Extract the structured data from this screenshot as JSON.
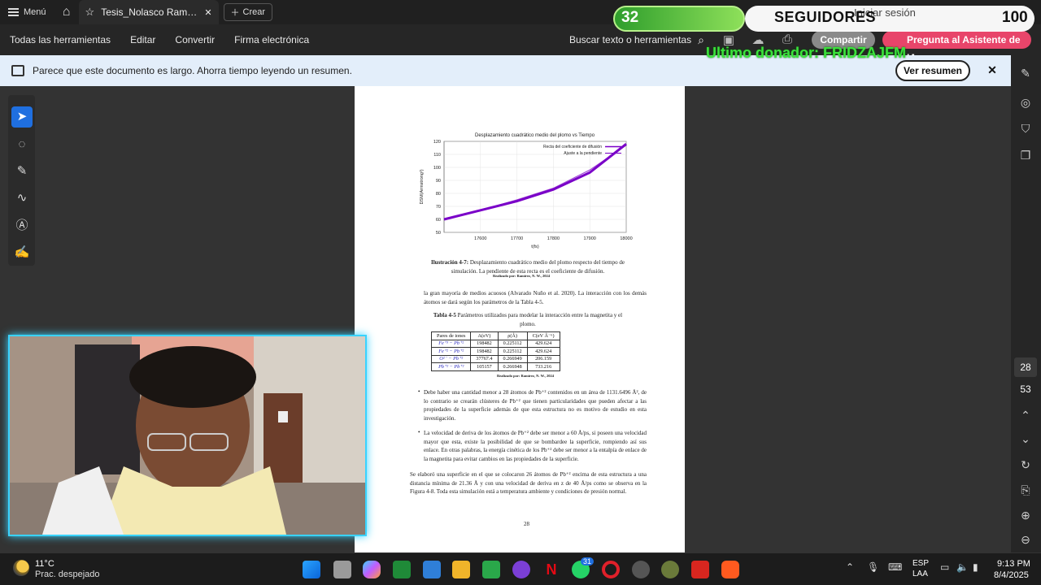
{
  "tabbar": {
    "menu_label": "Menú",
    "tab_title": "Tesis_Nolasco Ramire...",
    "create_label": "Crear"
  },
  "overlay": {
    "goal_current": "32",
    "goal_label": "SEGUIDORES",
    "goal_max": "100",
    "login_text": "Iniciar sesión",
    "donor_text": "Ultimo donador: FRIDZAJFM"
  },
  "menubar": {
    "items": [
      "Todas las herramientas",
      "Editar",
      "Convertir",
      "Firma electrónica"
    ],
    "search_label": "Buscar texto o herramientas",
    "share_label": "Compartir",
    "ai_label": "Pregunta al Asistente de IA"
  },
  "banner": {
    "text": "Parece que este documento es largo. Ahorra tiempo leyendo un resumen.",
    "button": "Ver resumen",
    "close": "✕"
  },
  "page_nav": {
    "current": "28",
    "total": "53"
  },
  "document": {
    "figure_caption_bold": "Ilustración 4-7:",
    "figure_caption": "Desplazamiento cuadrático medio del plomo respecto del tiempo de simulación. La pendiente de esta recta es el coeficiente de difusión.",
    "credit": "Realizado por: Ramírez, N. W., 2024",
    "para1": "la gran mayoría de medios acuosos (Alvarado Nuño et al. 2020). La interacción con los demás átomos se dará según los parámetros de la Tabla 4-5.",
    "table_title_bold": "Tabla 4-5",
    "table_title": "Parámetros utilizados para modelar la interacción entre la magnetita y el plomo.",
    "table_headers": [
      "Pares de iones",
      "A(eV)",
      "ρ(Å)",
      "C(eV Å⁻⁶)"
    ],
    "table_rows": [
      [
        "Fe⁺³ − Pb⁺²",
        "198482",
        "0.225112",
        "429.624"
      ],
      [
        "Fe⁺² − Pb⁺²",
        "198482",
        "0.225112",
        "429.624"
      ],
      [
        "O²⁻ − Pb⁺²",
        "37767.4",
        "0.266949",
        "206.159"
      ],
      [
        "Pb⁺² − Pb⁺²",
        "105157",
        "0.266948",
        "733.216"
      ]
    ],
    "bullet1": "Debe haber una cantidad menor a 28 átomos de Pb⁺² contenidos en un área de 1131.6496 Å², de lo contrario se crearán clústeres de Pb⁺² que tienen particularidades que pueden afectar a las propiedades de la superficie además de que esta estructura no es motivo de estudio en esta investigación.",
    "bullet2": "La velocidad de deriva de los átomos de Pb⁺² debe ser menor a 60 Å/ps, si poseen una velocidad mayor que esta, existe la posibilidad de que se bombardee la superficie, rompiendo así sus enlace. En otras palabras, la energía cinética de los Pb⁺² debe ser menor a la entalpía de enlace de la magnetita para evitar cambios en las propiedades de la superficie.",
    "para2": "Se elaboró una superficie en el que se colocaron 26 átomos de Pb⁺² encima de esta estructura a una distancia mínima de 21.36 Å y con una velocidad de deriva en z de 40 Å/ps como se observa en la Figura 4-8. Toda esta simulación está a temperatura ambiente y condiciones de presión normal.",
    "page_number": "28"
  },
  "chart_data": {
    "type": "line",
    "title": "Desplazamiento cuadrático medio del plomo vs Tiempo",
    "xlabel": "t(fs)",
    "ylabel": "DSM(Armstrong²)",
    "xlim": [
      17500,
      18000
    ],
    "ylim": [
      50,
      120
    ],
    "xticks": [
      17600,
      17700,
      17800,
      17900,
      18000
    ],
    "yticks": [
      50,
      60,
      70,
      80,
      90,
      100,
      110,
      120
    ],
    "legend_placement": "top-right",
    "series": [
      {
        "name": "Recta del coeficiente de difusión",
        "color": "#7a00c8",
        "x": [
          17500,
          17600,
          17700,
          17800,
          17900,
          18000
        ],
        "y": [
          60,
          67,
          74,
          83,
          96,
          118
        ]
      },
      {
        "name": "Ajuste a la pendiente",
        "color": "#7a00c8",
        "x": [
          17500,
          17600,
          17700,
          17800,
          17900,
          18000
        ],
        "y": [
          60,
          67,
          75,
          84,
          98,
          117
        ]
      }
    ]
  },
  "taskbar": {
    "temp": "11°C",
    "weather": "Prac. despejado",
    "lang1": "ESP",
    "lang2": "LAA",
    "time": "9:13 PM",
    "date": "8/4/2025",
    "whatsapp_badge": "31"
  }
}
